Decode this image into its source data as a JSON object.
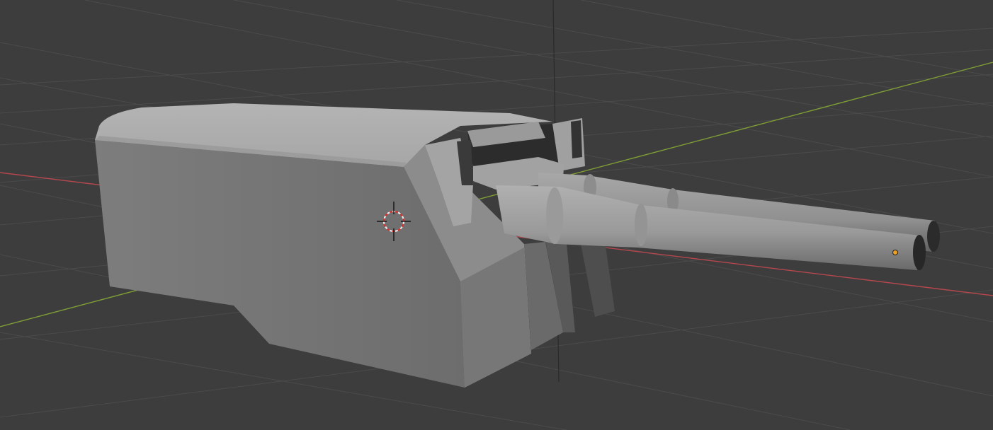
{
  "app": "3D viewport",
  "viewport": {
    "background": "#3d3d3d",
    "grid_color": "#4a4a4a",
    "x_axis_color": "#b5474e",
    "y_axis_color": "#7f9e35",
    "z_axis_color": "#2a2a2a"
  },
  "scene": {
    "object": "twin-barrel-gun-turret",
    "shading": "solid",
    "base_color": "#8a8a8a",
    "origin_dot_color": "#f0a020",
    "cursor_colors": [
      "#e0e0e0",
      "#d83030"
    ]
  }
}
